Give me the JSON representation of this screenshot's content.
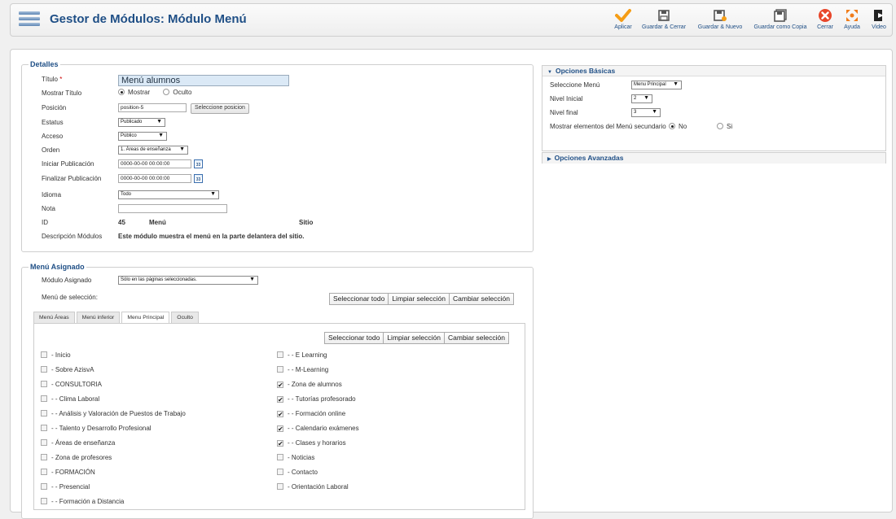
{
  "header": {
    "title": "Gestor de Módulos: Módulo Menú",
    "toolbar": [
      {
        "id": "apply",
        "label": "Aplicar",
        "icon": "checkmark-icon",
        "color": "#f59d16"
      },
      {
        "id": "save-close",
        "label": "Guardar & Cerrar",
        "icon": "save-icon",
        "color": "#555555"
      },
      {
        "id": "save-new",
        "label": "Guardar & Nuevo",
        "icon": "save-new-icon",
        "color": "#555555"
      },
      {
        "id": "save-copy",
        "label": "Guardar como Copia",
        "icon": "save-copy-icon",
        "color": "#555555"
      },
      {
        "id": "close",
        "label": "Cerrar",
        "icon": "close-icon",
        "color": "#e8462a"
      },
      {
        "id": "help",
        "label": "Ayuda",
        "icon": "help-icon",
        "color": "#f07c1a"
      },
      {
        "id": "video",
        "label": "Video",
        "icon": "video-icon",
        "color": "#222222"
      }
    ]
  },
  "details": {
    "legend": "Detalles",
    "title_label": "Título",
    "required_mark": "*",
    "title_value": "Menú alumnos",
    "show_title_label": "Mostrar Título",
    "show_title_options": [
      "Mostrar",
      "Oculto"
    ],
    "show_title_selected": "Mostrar",
    "position_label": "Posición",
    "position_value": "position-5",
    "position_button": "Seleccione posicion",
    "status_label": "Estatus",
    "status_value": "Publicado",
    "access_label": "Acceso",
    "access_value": "Público",
    "order_label": "Orden",
    "order_value": "1. Áreas de enseñanza",
    "start_label": "Iniciar Publicación",
    "start_value": "0000-00-00 00:00:00",
    "finish_label": "Finalizar Publicación",
    "finish_value": "0000-00-00 00:00:00",
    "calendar_label": "33",
    "language_label": "Idioma",
    "language_value": "Todo",
    "note_label": "Nota",
    "note_value": "",
    "id_label": "ID",
    "id_value": "45",
    "id_type": "Menú",
    "id_site": "Sitio",
    "desc_label": "Descripción Módulos",
    "desc_value": "Este módulo muestra el menú en la parte delantera del sitio."
  },
  "assignment": {
    "legend": "Menú Asignado",
    "assigned_label": "Módulo Asignado",
    "assigned_value": "Sólo en las páginas seleccionadas.",
    "selection_label": "Menú de selección:",
    "buttons": [
      "Seleccionar todo",
      "Limpiar selección",
      "Cambiar selección"
    ],
    "tabs": [
      "Menú Áreas",
      "Menú inferior",
      "Menu Principal",
      "Oculto"
    ],
    "active_tab": "Menu Principal",
    "inner_buttons": [
      "Seleccionar todo",
      "Limpiar selección",
      "Cambiar selección"
    ],
    "items_left": [
      {
        "label": "- Inicio",
        "checked": false
      },
      {
        "label": "- Sobre AzisvA",
        "checked": false
      },
      {
        "label": "- CONSULTORIA",
        "checked": false
      },
      {
        "label": "- - Clima Laboral",
        "checked": false
      },
      {
        "label": "- - Análisis y Valoración de Puestos de Trabajo",
        "checked": false
      },
      {
        "label": "- - Talento y Desarrollo Profesional",
        "checked": false
      },
      {
        "label": "- Áreas de enseñanza",
        "checked": false
      },
      {
        "label": "- Zona de profesores",
        "checked": false
      },
      {
        "label": "- FORMACIÓN",
        "checked": false
      },
      {
        "label": "- - Presencial",
        "checked": false
      },
      {
        "label": "- - Formación a Distancia",
        "checked": false
      }
    ],
    "items_right": [
      {
        "label": "- - E Learning",
        "checked": false
      },
      {
        "label": "- - M-Learning",
        "checked": false
      },
      {
        "label": "- Zona de alumnos",
        "checked": true
      },
      {
        "label": "- - Tutorías profesorado",
        "checked": true
      },
      {
        "label": "- - Formación online",
        "checked": true
      },
      {
        "label": "- - Calendario exámenes",
        "checked": true
      },
      {
        "label": "- - Clases y horarios",
        "checked": true
      },
      {
        "label": "- Noticias",
        "checked": false
      },
      {
        "label": "- Contacto",
        "checked": false
      },
      {
        "label": "- Orientación Laboral",
        "checked": false
      }
    ]
  },
  "basic_options": {
    "title": "Opciones Básicas",
    "menu_label": "Seleccione Menú",
    "menu_value": "Menu Principal",
    "start_level_label": "Nivel Inicial",
    "start_level_value": "2",
    "end_level_label": "Nivel final",
    "end_level_value": "3",
    "show_sub_label": "Mostrar elementos del Menú secundario",
    "show_sub_options": [
      "No",
      "Si"
    ],
    "show_sub_selected": "No"
  },
  "advanced_options": {
    "title": "Opciones Avanzadas"
  }
}
